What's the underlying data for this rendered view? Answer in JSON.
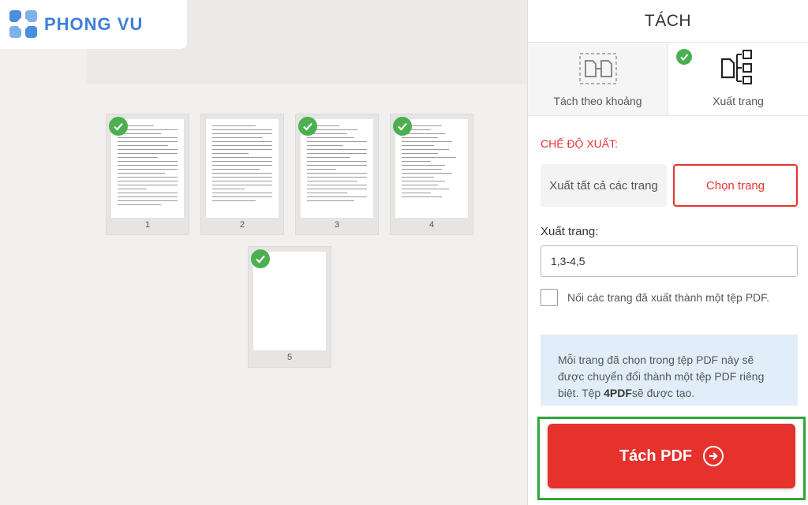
{
  "logo": {
    "text": "PHONG VU"
  },
  "pages": [
    {
      "number": "1",
      "selected": true
    },
    {
      "number": "2",
      "selected": false
    },
    {
      "number": "3",
      "selected": true
    },
    {
      "number": "4",
      "selected": true
    },
    {
      "number": "5",
      "selected": true
    }
  ],
  "panel": {
    "title": "TÁCH",
    "tabs": [
      {
        "label": "Tách theo khoảng",
        "icon": "split-range-icon",
        "active": false
      },
      {
        "label": "Xuất trang",
        "icon": "extract-pages-icon",
        "active": true
      }
    ],
    "mode_label": "CHẾ ĐỘ XUẤT:",
    "option_all": "Xuất tất cả các trang",
    "option_select": "Chọn trang",
    "pages_label": "Xuất trang:",
    "pages_value": "1,3-4,5",
    "merge_label": "Nối các trang đã xuất thành một tệp PDF.",
    "info_prefix": "Mỗi trang đã chọn trong tệp PDF này sẽ được chuyển đổi thành một tệp PDF riêng biệt. Tệp ",
    "info_bold": "4PDF",
    "info_suffix": "sẽ được tạo.",
    "split_button": "Tách PDF"
  },
  "colors": {
    "accent": "#e5322d",
    "check": "#4caf50",
    "highlight": "#2fa63a",
    "info_bg": "#e1eef9"
  }
}
